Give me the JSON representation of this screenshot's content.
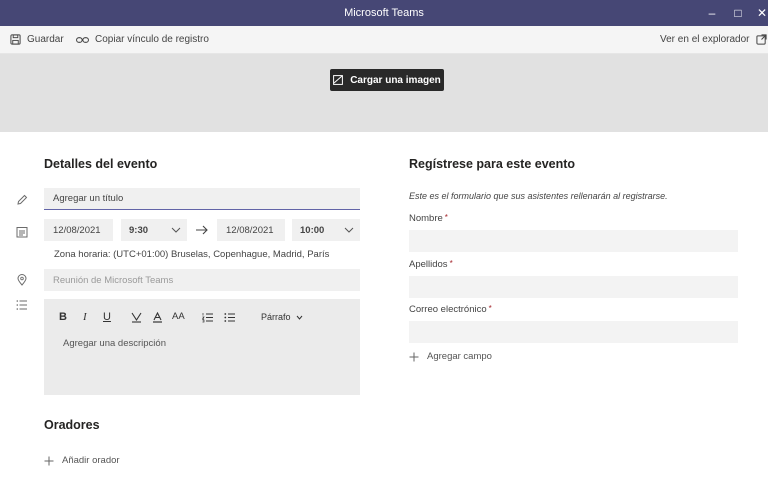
{
  "window": {
    "title": "Microsoft Teams",
    "minimize": "–",
    "maximize": "□",
    "close": "✕"
  },
  "toolbar": {
    "save_label": "Guardar",
    "copy_link_label": "Copiar vínculo de registro",
    "open_browser_label": "Ver en el explorador"
  },
  "banner": {
    "upload_label": "Cargar una imagen"
  },
  "event_details": {
    "heading": "Detalles del evento",
    "title_placeholder": "Agregar un título",
    "start_date": "12/08/2021",
    "start_time": "9:30",
    "end_date": "12/08/2021",
    "end_time": "10:00",
    "timezone": "Zona horaria: (UTC+01:00) Bruselas, Copenhague, Madrid, París",
    "location_placeholder": "Reunión de Microsoft Teams",
    "editor": {
      "bold": "B",
      "italic": "I",
      "underline": "U",
      "font_size": "AA",
      "paragraph_label": "Párrafo",
      "description_placeholder": "Agregar una descripción"
    }
  },
  "speakers": {
    "heading": "Oradores",
    "add_label": "Añadir orador"
  },
  "registration": {
    "heading": "Regístrese para este evento",
    "description": "Este es el formulario que sus asistentes rellenarán al registrarse.",
    "required_mark": "*",
    "fields": [
      {
        "label": "Nombre"
      },
      {
        "label": "Apellidos"
      },
      {
        "label": "Correo electrónico"
      }
    ],
    "add_field_label": "Agregar campo"
  },
  "colors": {
    "titlebar": "#464775",
    "accent": "#6264a7",
    "banner": "#e1e1e1",
    "upload_button": "#292929"
  }
}
